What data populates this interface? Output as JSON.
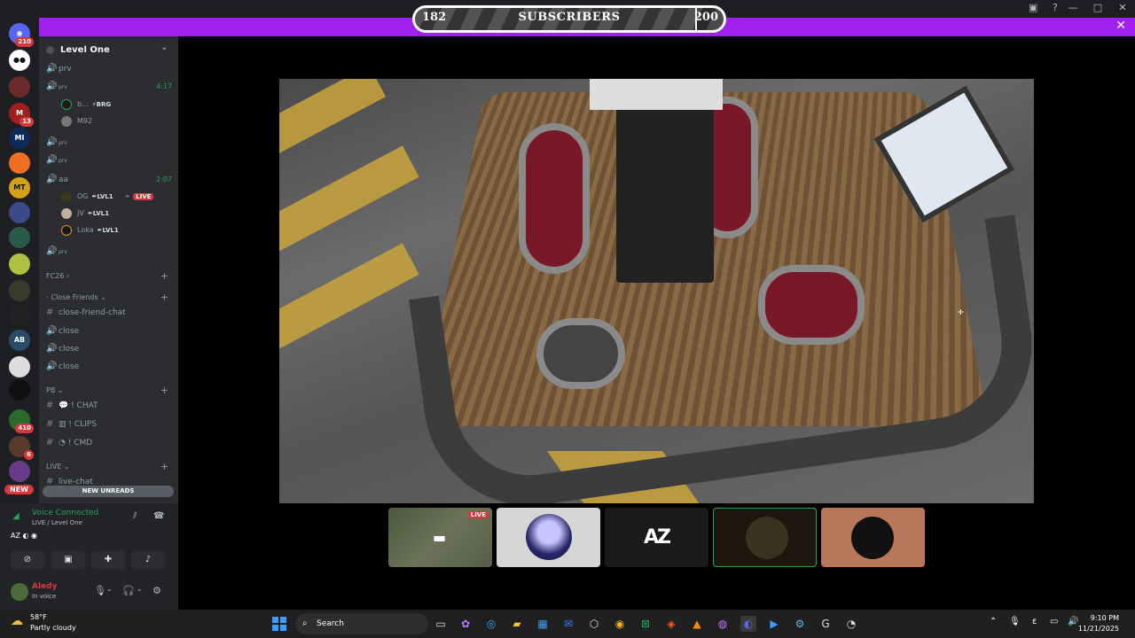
{
  "subscriber_goal": {
    "current": "182",
    "label": "SUBSCRIBERS",
    "goal": "200",
    "progress_fraction": 0.91
  },
  "server": {
    "name": "Level One"
  },
  "rail": {
    "badges": [
      "210",
      "13",
      "410",
      "6",
      "6"
    ],
    "new_label": "NEW"
  },
  "channels": {
    "prv": "prv",
    "prv2_label": "prv",
    "prv2_time": "4:17",
    "user_b": "b...",
    "user_b_tag": "BRG",
    "user_m92": "M92",
    "prv3": "prv",
    "prv4": "prv",
    "aa": "aa",
    "aa_time": "2:07",
    "og": "OG",
    "og_tag": "LVL1",
    "live": "LIVE",
    "jv": "JV",
    "jv_tag": "LVL1",
    "loka": "Loka",
    "loka_tag": "LVL1",
    "prv5": "prv",
    "fc26": "FC26",
    "close_friends": "Close Friends",
    "close_friend_chat": "close-friend-chat",
    "close1": "close",
    "close2": "close",
    "close3": "close",
    "pb": "PB",
    "chat": "CHAT",
    "clips": "CLIPS",
    "cmd": "CMD",
    "live_cat": "LIVE",
    "live_chat": "live-chat",
    "new_unreads": "NEW UNREADS"
  },
  "voice": {
    "status": "Voice Connected",
    "sub": "LIVE / Level One",
    "username": "Aledy",
    "user_status": "In voice"
  },
  "tiles": {
    "live": "LIVE",
    "t3_text": "AZ"
  },
  "taskbar": {
    "temp": "58°F",
    "condition": "Partly cloudy",
    "search": "Search",
    "time": "9:10 PM",
    "date": "11/21/2025"
  }
}
